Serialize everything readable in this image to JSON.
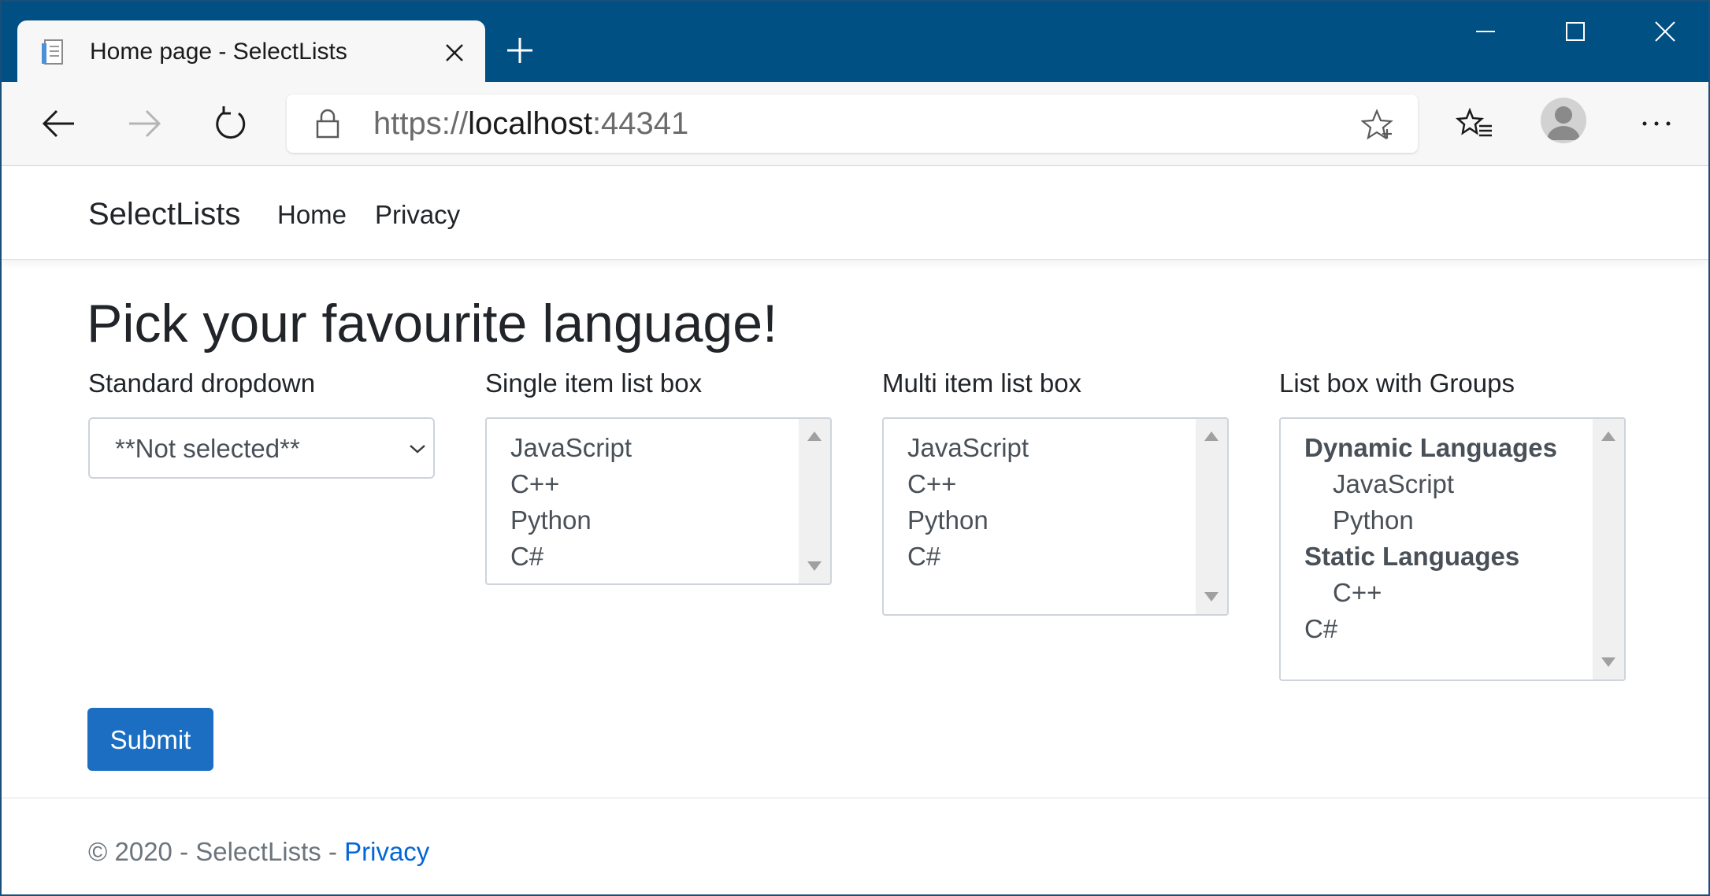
{
  "browser": {
    "tab_title": "Home page - SelectLists",
    "url_scheme": "https://",
    "url_host": "localhost",
    "url_port": ":44341",
    "colors": {
      "titlebar": "#005083",
      "toolbar": "#f7f7f7"
    }
  },
  "site": {
    "brand": "SelectLists",
    "nav": [
      "Home",
      "Privacy"
    ]
  },
  "main": {
    "heading": "Pick your favourite language!",
    "dropdown": {
      "label": "Standard dropdown",
      "value": "**Not selected**"
    },
    "single_list": {
      "label": "Single item list box",
      "options": [
        "JavaScript",
        "C++",
        "Python",
        "C#"
      ]
    },
    "multi_list": {
      "label": "Multi item list box",
      "options": [
        "JavaScript",
        "C++",
        "Python",
        "C#"
      ]
    },
    "grouped_list": {
      "label": "List box with Groups",
      "groups": [
        {
          "name": "Dynamic Languages",
          "options": [
            "JavaScript",
            "Python"
          ]
        },
        {
          "name": "Static Languages",
          "options": [
            "C++"
          ]
        }
      ],
      "ungrouped": [
        "C#"
      ]
    },
    "submit_label": "Submit"
  },
  "footer": {
    "text": "© 2020 - SelectLists - ",
    "link": "Privacy"
  },
  "colors": {
    "primary": "#1b6ec2",
    "link": "#0366d6"
  }
}
